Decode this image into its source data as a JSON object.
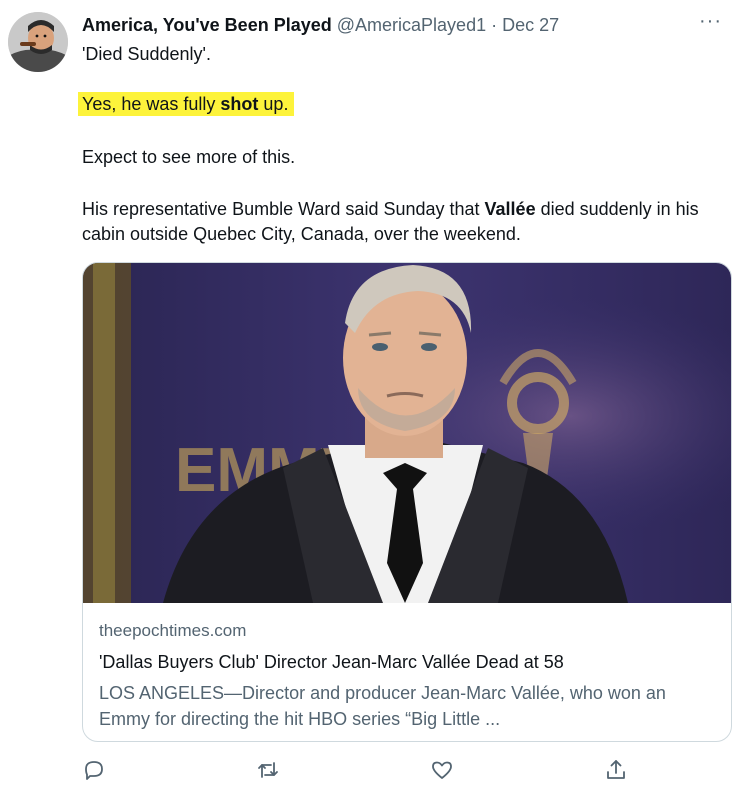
{
  "tweet": {
    "author": {
      "display_name": "America, You've Been Played",
      "handle": "@AmericaPlayed1",
      "separator": "·",
      "date": "Dec 27"
    },
    "more_label": "···",
    "text": {
      "line1": "'Died Suddenly'.",
      "highlight_pre": "Yes, he was fully ",
      "highlight_bold": "shot",
      "highlight_post": " up.",
      "line3": "Expect to see more of this.",
      "line4_pre": "His representative Bumble Ward said Sunday that ",
      "line4_bold": "Vallée",
      "line4_post": " died suddenly in his cabin outside Quebec City, Canada, over the weekend."
    },
    "highlight_color": "#fdf33b"
  },
  "card": {
    "domain": "theepochtimes.com",
    "title": "'Dallas Buyers Club' Director Jean-Marc Vallée Dead at 58",
    "description": "LOS ANGELES—Director and producer Jean-Marc Vallée, who won an Emmy for directing the hit HBO series “Big Little ...",
    "image_backdrop_text": "EMMYS"
  },
  "actions": [
    {
      "name": "reply",
      "icon": "reply-icon"
    },
    {
      "name": "retweet",
      "icon": "retweet-icon"
    },
    {
      "name": "like",
      "icon": "heart-icon"
    },
    {
      "name": "share",
      "icon": "share-icon"
    }
  ],
  "colors": {
    "text_primary": "#0f1419",
    "text_secondary": "#536471",
    "border": "#cfd9de"
  }
}
